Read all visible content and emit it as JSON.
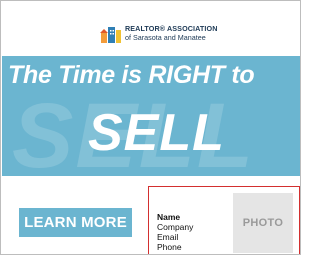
{
  "logo": {
    "line1": "REALTOR® ASSOCIATION",
    "line2": "of Sarasota and Manatee",
    "icon": "house-building-icon"
  },
  "hero": {
    "headline": "The Time is RIGHT to",
    "big_word": "SELL",
    "background_word": "SELL"
  },
  "cta": {
    "label": "LEARN MORE"
  },
  "agent": {
    "name": "Name",
    "company": "Company",
    "email": "Email",
    "phone": "Phone",
    "photo_label": "PHOTO"
  },
  "colors": {
    "accent": "#6bb5d0",
    "brand_text": "#1e3a56",
    "agent_border": "#d32f2f"
  }
}
